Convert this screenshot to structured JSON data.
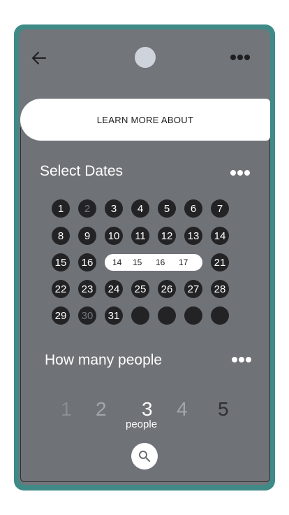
{
  "banner": {
    "label": "LEARN MORE ABOUT"
  },
  "dates": {
    "title": "Select Dates",
    "rows": [
      [
        "1",
        "2",
        "3",
        "4",
        "5",
        "6",
        "7"
      ],
      [
        "8",
        "9",
        "10",
        "11",
        "12",
        "13",
        "14"
      ],
      [
        "15",
        "16",
        "21"
      ],
      [
        "22",
        "23",
        "24",
        "25",
        "26",
        "27",
        "28"
      ],
      [
        "29",
        "30",
        "31",
        "",
        "",
        "",
        ""
      ]
    ],
    "muted_days": [
      "2",
      "30"
    ],
    "selected_range": [
      "14",
      "15",
      "16",
      "17"
    ]
  },
  "people": {
    "title": "How many people",
    "options": [
      "1",
      "2",
      "3",
      "4",
      "5"
    ],
    "selected": "3",
    "unit_label": "people"
  },
  "icons": {
    "back": "back-arrow-icon",
    "avatar": "avatar",
    "menu": "more-dots-icon",
    "search": "search-icon"
  },
  "colors": {
    "frame": "#3f8a86",
    "screen": "#72757a",
    "day_circle": "#232325",
    "banner": "#ffffff"
  }
}
